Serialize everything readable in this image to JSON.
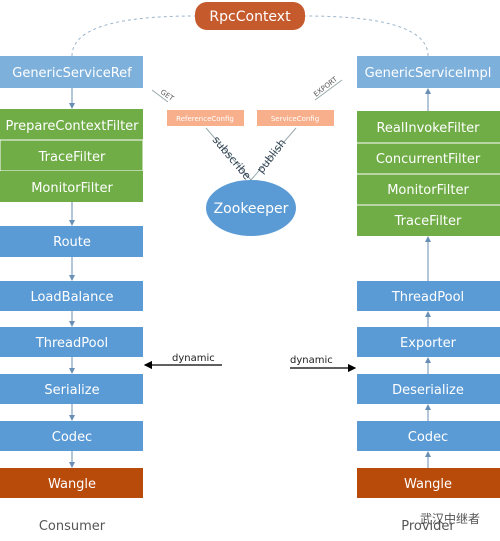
{
  "rpc_context": "RpcContext",
  "consumer": {
    "label": "Consumer",
    "service_ref": "GenericServiceRef",
    "filters": [
      "PrepareContextFilter",
      "TraceFilter",
      "MonitorFilter"
    ],
    "stack": [
      "Route",
      "LoadBalance",
      "ThreadPool",
      "Serialize",
      "Codec"
    ],
    "transport": "Wangle"
  },
  "provider": {
    "label": "Provider",
    "service_impl": "GenericServiceImpl",
    "filters": [
      "RealInvokeFilter",
      "ConcurrentFilter",
      "MonitorFilter",
      "TraceFilter"
    ],
    "stack": [
      "ThreadPool",
      "Exporter",
      "Deserialize",
      "Codec"
    ],
    "transport": "Wangle"
  },
  "registry": {
    "name": "Zookeeper",
    "reference_config": "ReferenceConfig",
    "service_config": "ServiceConfig",
    "subscribe": "subscribe",
    "publish": "publish",
    "get": "GET",
    "export": "EXPORT"
  },
  "dynamic_left": "dynamic",
  "dynamic_right": "dynamic",
  "watermark": "武汉中继者",
  "colors": {
    "blue": "#5b9bd5",
    "light_blue": "#7eb0dc",
    "green": "#70ad47",
    "orange": "#b84a0a",
    "salmon": "#f8b08c",
    "rpc": "#c55a2d"
  }
}
